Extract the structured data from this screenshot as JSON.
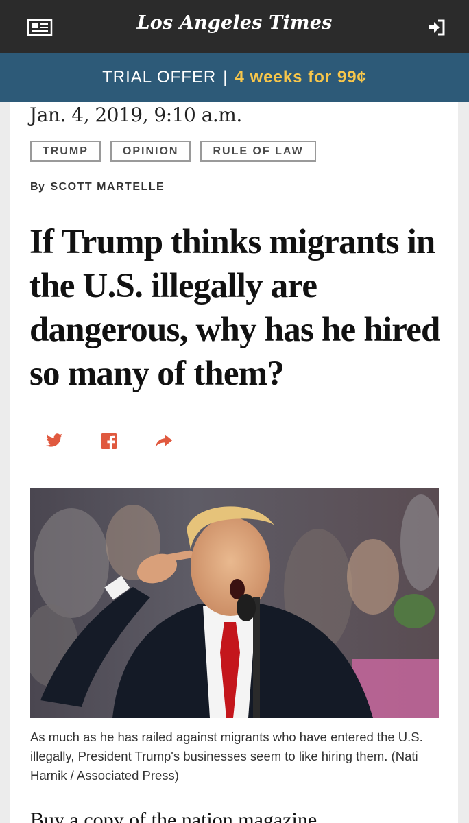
{
  "header": {
    "logo_text": "Los Angeles Times",
    "menu_icon": "newspaper-icon",
    "login_icon": "sign-in-icon"
  },
  "promo": {
    "label": "TRIAL OFFER",
    "separator": "|",
    "offer": "4 weeks for 99¢",
    "colors": {
      "background": "#2d5a78",
      "offer": "#f7c64b"
    }
  },
  "article": {
    "date": "Jan. 4, 2019, 9:10 a.m.",
    "tags": [
      "TRUMP",
      "OPINION",
      "RULE OF LAW"
    ],
    "byline_prefix": "By",
    "author": "SCOTT MARTELLE",
    "headline": "If Trump thinks migrants in the U.S. illegally are dangerous, why has he hired so many of them?",
    "share": {
      "icons": [
        "twitter-icon",
        "facebook-icon",
        "share-arrow-icon"
      ],
      "color": "#e0593f"
    },
    "caption": "As much as he has railed against migrants who have entered the U.S. illegally, President Trump's businesses seem to like hiring them. (Nati Harnik / Associated Press)",
    "body_peek": "Buy a copy of the nation magazine"
  }
}
